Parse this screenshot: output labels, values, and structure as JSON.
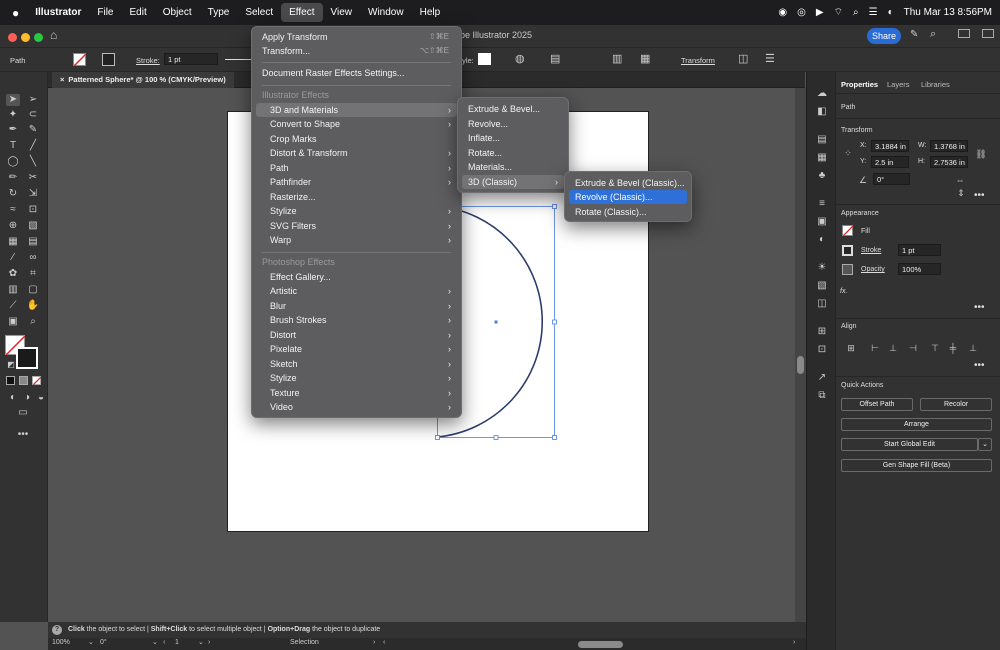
{
  "menubar": {
    "apple": "",
    "app": "Illustrator",
    "items": [
      "File",
      "Edit",
      "Object",
      "Type",
      "Select",
      "Effect",
      "View",
      "Window",
      "Help"
    ],
    "datetime": "Thu Mar 13  8:56PM"
  },
  "title": {
    "app_title": "be Illustrator 2025",
    "share": "Share"
  },
  "control": {
    "selection": "Path",
    "stroke_label": "Stroke:",
    "stroke_value": "1 pt",
    "style_label": "tyle:",
    "transform": "Transform"
  },
  "document": {
    "tab": "Patterned Sphere* @ 100 % (CMYK/Preview)"
  },
  "effect_menu": {
    "apply_transform": "Apply Transform",
    "apply_transform_sc": "⇧⌘E",
    "transform": "Transform...",
    "transform_sc": "⌥⇧⌘E",
    "raster_settings": "Document Raster Effects Settings...",
    "illustrator_header": "Illustrator Effects",
    "illustrator_items": [
      "3D and Materials",
      "Convert to Shape",
      "Crop Marks",
      "Distort & Transform",
      "Path",
      "Pathfinder",
      "Rasterize...",
      "Stylize",
      "SVG Filters",
      "Warp"
    ],
    "photoshop_header": "Photoshop Effects",
    "photoshop_items": [
      "Effect Gallery...",
      "Artistic",
      "Blur",
      "Brush Strokes",
      "Distort",
      "Pixelate",
      "Sketch",
      "Stylize",
      "Texture",
      "Video"
    ]
  },
  "submenu_3d": {
    "items": [
      "Extrude & Bevel...",
      "Revolve...",
      "Inflate...",
      "Rotate...",
      "Materials...",
      "3D (Classic)"
    ]
  },
  "submenu_classic": {
    "items": [
      "Extrude & Bevel (Classic)...",
      "Revolve (Classic)...",
      "Rotate (Classic)..."
    ]
  },
  "panel": {
    "tabs": [
      "Properties",
      "Layers",
      "Libraries"
    ],
    "path": "Path",
    "transform_title": "Transform",
    "x_label": "X:",
    "x": "3.1884 in",
    "w_label": "W:",
    "w": "1.3768 in",
    "y_label": "Y:",
    "y": "2.5 in",
    "h_label": "H:",
    "h": "2.7536 in",
    "angle": "0°",
    "appearance_title": "Appearance",
    "fill": "Fill",
    "stroke": "Stroke",
    "stroke_value": "1 pt",
    "opacity": "Opacity",
    "opacity_value": "100%",
    "fx": "fx.",
    "align_title": "Align",
    "quick_actions_title": "Quick Actions",
    "offset_path": "Offset Path",
    "recolor": "Recolor",
    "arrange": "Arrange",
    "start_global_edit": "Start Global Edit",
    "gen_shape_fill": "Gen Shape Fill (Beta)"
  },
  "status": {
    "b1": "Click",
    "t1": " the object to select  |  ",
    "b2": "Shift+Click",
    "t2": " to select multiple object  |  ",
    "b3": "Option+Drag",
    "t3": " the object to duplicate"
  },
  "bottom": {
    "zoom": "100%",
    "angle": "0°",
    "artboard": "1",
    "tool": "Selection"
  },
  "colors": {
    "accent": "#2f6fd8",
    "selection": "#4a7fe0",
    "curve": "#2c3d6e"
  }
}
